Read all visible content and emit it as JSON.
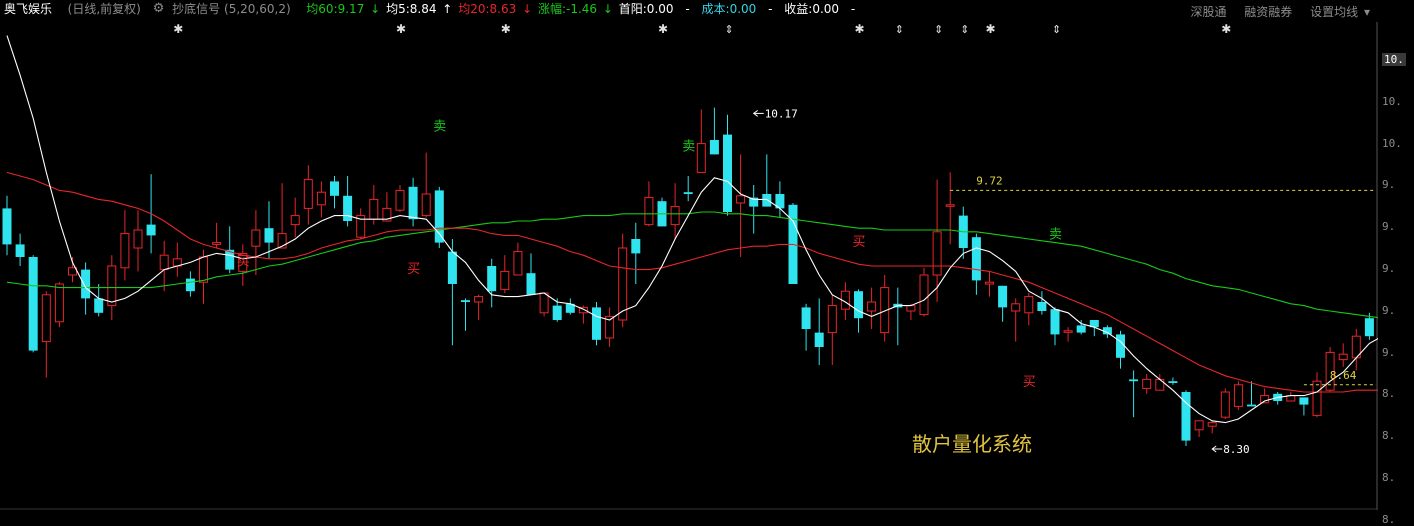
{
  "header": {
    "stock_name": "奥飞娱乐",
    "period": "(日线,前复权)",
    "indicator_name": "抄底信号",
    "indicator_params": "(5,20,60,2)",
    "ma60": "均60:9.17",
    "ma5": "均5:8.84",
    "ma20": "均20:8.63",
    "change": "涨幅:-1.46",
    "first_yang": "首阳:0.00",
    "cost": "成本:0.00",
    "profit": "收益:0.00",
    "dash": "-",
    "right_links": [
      "深股通",
      "融资融券",
      "设置均线"
    ]
  },
  "watermark": "散户量化系统",
  "chart_data": {
    "type": "candlestick",
    "ylim": [
      8.0,
      10.6
    ],
    "yticks": [
      "10.",
      "10.",
      "10.",
      "9.",
      "9.",
      "9.",
      "9.",
      "9.",
      "8.",
      "8.",
      "8.",
      "8."
    ],
    "highlight_tick": "10.",
    "colors": {
      "up": "#e8262a",
      "down": "#2fe4ee",
      "ma5": "#ffffff",
      "ma20": "#e8262a",
      "ma60": "#19c819",
      "annot": "#e0d341"
    },
    "candles": [
      [
        9.62,
        9.42,
        9.69,
        9.36
      ],
      [
        9.42,
        9.35,
        9.48,
        9.3
      ],
      [
        9.35,
        8.83,
        9.36,
        8.82
      ],
      [
        8.88,
        9.14,
        9.16,
        8.68
      ],
      [
        8.99,
        9.2,
        9.21,
        8.96
      ],
      [
        9.25,
        9.29,
        9.35,
        9.21
      ],
      [
        9.28,
        9.12,
        9.32,
        9.03
      ],
      [
        9.12,
        9.04,
        9.2,
        9.02
      ],
      [
        9.08,
        9.3,
        9.36,
        9.0
      ],
      [
        9.29,
        9.48,
        9.61,
        9.22
      ],
      [
        9.4,
        9.5,
        9.61,
        9.27
      ],
      [
        9.53,
        9.47,
        9.81,
        9.37
      ],
      [
        9.28,
        9.36,
        9.44,
        9.16
      ],
      [
        9.3,
        9.34,
        9.43,
        9.24
      ],
      [
        9.23,
        9.16,
        9.27,
        9.13
      ],
      [
        9.21,
        9.35,
        9.39,
        9.09
      ],
      [
        9.42,
        9.43,
        9.54,
        9.4
      ],
      [
        9.39,
        9.28,
        9.52,
        9.26
      ],
      [
        9.27,
        9.37,
        9.42,
        9.19
      ],
      [
        9.41,
        9.5,
        9.61,
        9.25
      ],
      [
        9.51,
        9.43,
        9.66,
        9.34
      ],
      [
        9.4,
        9.48,
        9.76,
        9.45
      ],
      [
        9.53,
        9.58,
        9.68,
        9.46
      ],
      [
        9.62,
        9.78,
        9.86,
        9.53
      ],
      [
        9.64,
        9.71,
        9.77,
        9.57
      ],
      [
        9.77,
        9.69,
        9.8,
        9.62
      ],
      [
        9.69,
        9.55,
        9.8,
        9.52
      ],
      [
        9.46,
        9.58,
        9.62,
        9.45
      ],
      [
        9.56,
        9.67,
        9.75,
        9.53
      ],
      [
        9.55,
        9.62,
        9.71,
        9.58
      ],
      [
        9.61,
        9.72,
        9.75,
        9.6
      ],
      [
        9.74,
        9.56,
        9.79,
        9.52
      ],
      [
        9.58,
        9.7,
        9.93,
        9.57
      ],
      [
        9.72,
        9.43,
        9.74,
        9.4
      ],
      [
        9.38,
        9.2,
        9.45,
        8.86
      ],
      [
        9.11,
        9.1,
        9.12,
        8.94
      ],
      [
        9.1,
        9.13,
        9.14,
        9.0
      ],
      [
        9.3,
        9.16,
        9.34,
        9.07
      ],
      [
        9.17,
        9.27,
        9.36,
        9.15
      ],
      [
        9.25,
        9.38,
        9.43,
        9.25
      ],
      [
        9.26,
        9.14,
        9.37,
        9.14
      ],
      [
        9.04,
        9.15,
        9.14,
        9.02
      ],
      [
        9.08,
        9.0,
        9.12,
        8.99
      ],
      [
        9.09,
        9.04,
        9.12,
        9.03
      ],
      [
        9.04,
        9.07,
        9.08,
        8.98
      ],
      [
        9.07,
        8.89,
        9.1,
        8.86
      ],
      [
        8.9,
        9.02,
        9.07,
        8.85
      ],
      [
        9.0,
        9.4,
        9.48,
        8.96
      ],
      [
        9.45,
        9.37,
        9.54,
        9.2
      ],
      [
        9.53,
        9.68,
        9.77,
        9.52
      ],
      [
        9.66,
        9.52,
        9.68,
        9.52
      ],
      [
        9.53,
        9.63,
        9.76,
        9.45
      ],
      [
        9.71,
        9.7,
        9.8,
        9.66
      ],
      [
        9.82,
        9.98,
        10.17,
        9.82
      ],
      [
        10.0,
        9.92,
        10.18,
        9.92
      ],
      [
        10.03,
        9.6,
        10.14,
        9.58
      ],
      [
        9.65,
        9.69,
        9.92,
        9.35
      ],
      [
        9.68,
        9.63,
        9.75,
        9.48
      ],
      [
        9.7,
        9.63,
        9.92,
        9.64
      ],
      [
        9.7,
        9.62,
        9.77,
        9.57
      ],
      [
        9.64,
        9.2,
        9.65,
        9.2
      ],
      [
        9.07,
        8.95,
        9.09,
        8.83
      ],
      [
        8.93,
        8.85,
        9.12,
        8.75
      ],
      [
        8.93,
        9.08,
        9.14,
        8.75
      ],
      [
        9.06,
        9.16,
        9.21,
        9.0
      ],
      [
        9.16,
        9.01,
        9.17,
        8.93
      ],
      [
        9.05,
        9.1,
        9.18,
        8.95
      ],
      [
        8.93,
        9.18,
        9.25,
        8.88
      ],
      [
        9.09,
        9.07,
        9.18,
        8.86
      ],
      [
        9.05,
        9.08,
        9.09,
        9.0
      ],
      [
        9.03,
        9.25,
        9.29,
        9.02
      ],
      [
        9.25,
        9.49,
        9.78,
        9.1
      ],
      [
        9.64,
        9.64,
        9.82,
        9.42
      ],
      [
        9.58,
        9.4,
        9.63,
        9.34
      ],
      [
        9.46,
        9.22,
        9.48,
        9.14
      ],
      [
        9.2,
        9.21,
        9.27,
        9.13
      ],
      [
        9.19,
        9.07,
        9.19,
        8.99
      ],
      [
        9.05,
        9.09,
        9.12,
        8.88
      ],
      [
        9.04,
        9.13,
        9.15,
        8.97
      ],
      [
        9.1,
        9.05,
        9.16,
        9.03
      ],
      [
        9.06,
        8.92,
        9.07,
        8.86
      ],
      [
        8.94,
        8.94,
        8.96,
        8.88
      ],
      [
        8.97,
        8.93,
        9.0,
        8.92
      ],
      [
        9.0,
        8.96,
        9.0,
        8.91
      ],
      [
        8.96,
        8.92,
        8.97,
        8.9
      ],
      [
        8.92,
        8.79,
        8.94,
        8.73
      ],
      [
        8.67,
        8.66,
        8.72,
        8.46
      ],
      [
        8.62,
        8.67,
        8.7,
        8.59
      ],
      [
        8.61,
        8.67,
        8.7,
        8.61
      ],
      [
        8.66,
        8.65,
        8.68,
        8.64
      ],
      [
        8.6,
        8.33,
        8.61,
        8.3
      ],
      [
        8.39,
        8.44,
        8.43,
        8.35
      ],
      [
        8.41,
        8.43,
        8.44,
        8.37
      ],
      [
        8.46,
        8.6,
        8.62,
        8.45
      ],
      [
        8.52,
        8.64,
        8.66,
        8.5
      ],
      [
        8.53,
        8.52,
        8.66,
        8.52
      ],
      [
        8.54,
        8.58,
        8.62,
        8.55
      ],
      [
        8.59,
        8.55,
        8.6,
        8.53
      ],
      [
        8.55,
        8.58,
        8.6,
        8.56
      ],
      [
        8.57,
        8.53,
        8.57,
        8.47
      ],
      [
        8.47,
        8.66,
        8.71,
        8.46
      ],
      [
        8.61,
        8.82,
        8.85,
        8.6
      ],
      [
        8.78,
        8.81,
        8.87,
        8.74
      ],
      [
        8.79,
        8.91,
        8.95,
        8.72
      ],
      [
        9.01,
        8.91,
        9.04,
        8.89
      ],
      [
        8.94,
        8.84,
        8.97,
        8.81
      ]
    ],
    "ma5": [
      10.58,
      10.36,
      10.12,
      9.82,
      9.55,
      9.32,
      9.18,
      9.12,
      9.1,
      9.12,
      9.16,
      9.22,
      9.28,
      9.3,
      9.32,
      9.35,
      9.37,
      9.36,
      9.34,
      9.35,
      9.38,
      9.41,
      9.45,
      9.51,
      9.55,
      9.58,
      9.58,
      9.56,
      9.56,
      9.56,
      9.58,
      9.57,
      9.56,
      9.48,
      9.38,
      9.32,
      9.22,
      9.14,
      9.13,
      9.13,
      9.14,
      9.15,
      9.1,
      9.09,
      9.06,
      9.02,
      9.0,
      9.05,
      9.08,
      9.18,
      9.3,
      9.45,
      9.58,
      9.71,
      9.79,
      9.77,
      9.7,
      9.67,
      9.67,
      9.62,
      9.55,
      9.39,
      9.25,
      9.14,
      9.1,
      9.05,
      9.02,
      9.05,
      9.08,
      9.08,
      9.11,
      9.18,
      9.29,
      9.37,
      9.4,
      9.38,
      9.33,
      9.27,
      9.16,
      9.12,
      9.06,
      9.04,
      8.98,
      8.96,
      8.93,
      8.88,
      8.8,
      8.73,
      8.67,
      8.61,
      8.54,
      8.48,
      8.44,
      8.43,
      8.45,
      8.5,
      8.55,
      8.57,
      8.58,
      8.58,
      8.6,
      8.66,
      8.71,
      8.79,
      8.87,
      8.91
    ],
    "ma20": [
      9.82,
      9.8,
      9.78,
      9.75,
      9.72,
      9.71,
      9.69,
      9.67,
      9.66,
      9.64,
      9.62,
      9.59,
      9.55,
      9.5,
      9.45,
      9.42,
      9.4,
      9.38,
      9.36,
      9.35,
      9.34,
      9.34,
      9.35,
      9.37,
      9.4,
      9.42,
      9.44,
      9.45,
      9.47,
      9.49,
      9.5,
      9.5,
      9.5,
      9.51,
      9.51,
      9.51,
      9.5,
      9.48,
      9.47,
      9.47,
      9.45,
      9.43,
      9.41,
      9.38,
      9.36,
      9.33,
      9.3,
      9.29,
      9.28,
      9.28,
      9.29,
      9.31,
      9.33,
      9.35,
      9.37,
      9.39,
      9.4,
      9.41,
      9.41,
      9.42,
      9.42,
      9.4,
      9.37,
      9.35,
      9.33,
      9.31,
      9.3,
      9.3,
      9.3,
      9.3,
      9.3,
      9.3,
      9.3,
      9.29,
      9.28,
      9.27,
      9.25,
      9.23,
      9.21,
      9.18,
      9.15,
      9.12,
      9.09,
      9.06,
      9.03,
      8.99,
      8.95,
      8.91,
      8.87,
      8.83,
      8.79,
      8.75,
      8.72,
      8.69,
      8.67,
      8.65,
      8.63,
      8.62,
      8.61,
      8.6,
      8.6,
      8.6,
      8.6,
      8.61,
      8.61,
      8.61
    ],
    "ma60": [
      9.21,
      9.2,
      9.19,
      9.19,
      9.18,
      9.18,
      9.18,
      9.18,
      9.18,
      9.18,
      9.18,
      9.18,
      9.19,
      9.2,
      9.21,
      9.22,
      9.24,
      9.25,
      9.26,
      9.28,
      9.3,
      9.31,
      9.33,
      9.35,
      9.37,
      9.39,
      9.41,
      9.43,
      9.44,
      9.46,
      9.47,
      9.48,
      9.49,
      9.5,
      9.51,
      9.52,
      9.53,
      9.54,
      9.54,
      9.55,
      9.55,
      9.56,
      9.56,
      9.57,
      9.58,
      9.58,
      9.58,
      9.59,
      9.59,
      9.59,
      9.59,
      9.59,
      9.59,
      9.6,
      9.6,
      9.59,
      9.59,
      9.58,
      9.58,
      9.57,
      9.56,
      9.55,
      9.54,
      9.53,
      9.52,
      9.51,
      9.51,
      9.5,
      9.5,
      9.5,
      9.5,
      9.5,
      9.5,
      9.49,
      9.49,
      9.48,
      9.47,
      9.46,
      9.45,
      9.44,
      9.43,
      9.42,
      9.41,
      9.39,
      9.37,
      9.35,
      9.33,
      9.31,
      9.28,
      9.26,
      9.23,
      9.21,
      9.19,
      9.18,
      9.17,
      9.15,
      9.13,
      9.11,
      9.09,
      9.08,
      9.06,
      9.05,
      9.04,
      9.03,
      9.02,
      9.01
    ],
    "signals": [
      {
        "i": 18,
        "text": "买",
        "type": "buy",
        "price": 9.38
      },
      {
        "i": 31,
        "text": "买",
        "type": "buy",
        "price": 9.34
      },
      {
        "i": 33,
        "text": "卖",
        "type": "sell",
        "price": 10.03
      },
      {
        "i": 52,
        "text": "卖",
        "type": "sell",
        "price": 9.92
      },
      {
        "i": 65,
        "text": "买",
        "type": "buy",
        "price": 9.49
      },
      {
        "i": 78,
        "text": "买",
        "type": "buy",
        "price": 8.71
      },
      {
        "i": 80,
        "text": "卖",
        "type": "sell",
        "price": 9.43
      }
    ],
    "star_markers": [
      13,
      30,
      38,
      50,
      65,
      75,
      93,
      105
    ],
    "updown_markers": [
      55,
      68,
      71,
      73,
      80
    ],
    "annotations": [
      {
        "i": 57,
        "text": "10.17",
        "price": 10.17,
        "arrow": "left"
      },
      {
        "i": 72,
        "text": "9.72",
        "price": 9.72,
        "dashed_line": true
      },
      {
        "i": 99,
        "text": "8.64",
        "price": 8.64,
        "dashed_line": true
      },
      {
        "i": 92,
        "text": "8.30",
        "price": 8.3,
        "arrow": "left"
      }
    ]
  }
}
